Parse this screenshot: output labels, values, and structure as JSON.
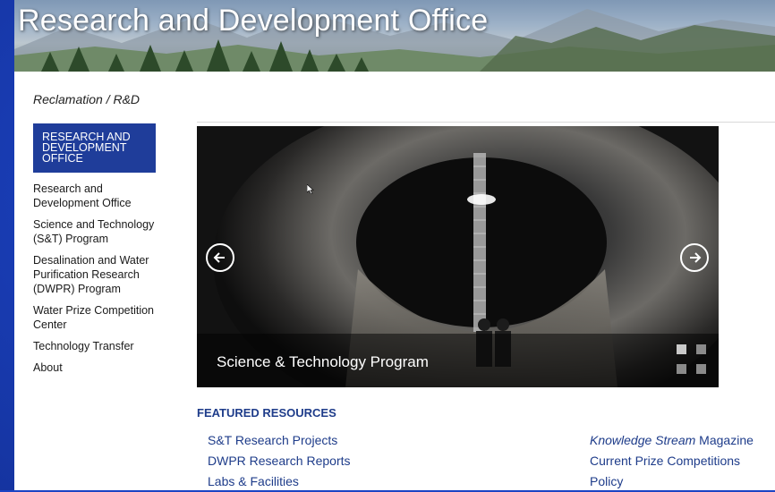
{
  "header": {
    "title": "Research and Development Office"
  },
  "breadcrumb": "Reclamation / R&D",
  "sidebar": {
    "header": "RESEARCH AND DEVELOPMENT OFFICE",
    "items": [
      {
        "label": "Research and Development Office"
      },
      {
        "label": "Science and Technology (S&T) Program"
      },
      {
        "label": "Desalination and Water Purification Research (DWPR) Program"
      },
      {
        "label": "Water Prize Competition Center"
      },
      {
        "label": "Technology Transfer"
      },
      {
        "label": "About"
      }
    ]
  },
  "carousel": {
    "caption": "Science & Technology Program",
    "slide_count": 4,
    "active_slide": 1,
    "prev_icon": "arrow-left-icon",
    "next_icon": "arrow-right-icon"
  },
  "featured": {
    "heading": "FEATURED RESOURCES",
    "left_links": [
      {
        "label": "S&T Research Projects"
      },
      {
        "label": "DWPR Research Reports"
      },
      {
        "label": "Labs & Facilities"
      }
    ],
    "right_links": [
      {
        "label_italic": "Knowledge Stream",
        "label_rest": " Magazine"
      },
      {
        "label": "Current Prize Competitions"
      },
      {
        "label": "Policy"
      }
    ]
  },
  "colors": {
    "page_background": "#1b44c4",
    "sidebar_header": "#1f3d9a",
    "link": "#1e3c8a"
  }
}
